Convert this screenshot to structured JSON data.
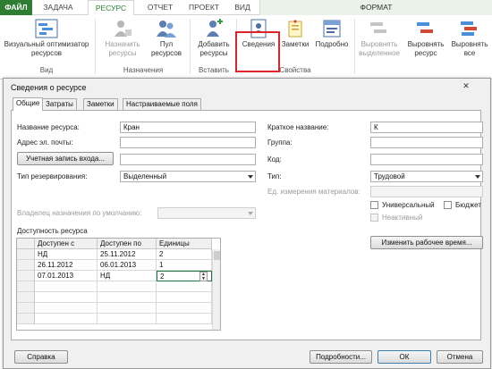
{
  "ribbon": {
    "tabs": [
      "ФАЙЛ",
      "ЗАДАЧА",
      "РЕСУРС",
      "ОТЧЕТ",
      "ПРОЕКТ",
      "ВИД"
    ],
    "format_tab": "ФОРМАТ",
    "buttons": {
      "optimizer": "Визуальный оптимизатор ресурсов",
      "assign": "Назначить ресурсы",
      "pool": "Пул ресурсов",
      "add": "Добавить ресурсы",
      "info": "Сведения",
      "notes": "Заметки",
      "details": "Подробно",
      "level_selection": "Выровнять выделенное",
      "level_resource": "Выровнять ресурс",
      "level_all": "Выровнять все"
    },
    "groups": {
      "view": "Вид",
      "assignments": "Назначения",
      "insert": "Вставить",
      "properties": "Свойства"
    },
    "colors": {
      "file_tab": "#2f7d32",
      "active_tab_text": "#2f7d32",
      "highlight": "#e0232a"
    }
  },
  "dialog": {
    "title": "Сведения о ресурсе",
    "close": "✕",
    "tabs": [
      "Общие",
      "Затраты",
      "Заметки",
      "Настраиваемые поля"
    ],
    "fields": {
      "name_label": "Название ресурса:",
      "name_value": "Кран",
      "email_label": "Адрес эл. почты:",
      "email_value": "",
      "account_button": "Учетная запись входа...",
      "booking_label": "Тип резервирования:",
      "booking_value": "Выделенный",
      "owner_label": "Владелец назначения по умолчанию:",
      "owner_value": "",
      "short_label": "Краткое название:",
      "short_value": "К",
      "group_label": "Группа:",
      "group_value": "",
      "code_label": "Код:",
      "code_value": "",
      "type_label": "Тип:",
      "type_value": "Трудовой",
      "material_label": "Ед. измерения материалов:",
      "material_value": "",
      "generic_label": "Универсальный",
      "budget_label": "Бюджет",
      "inactive_label": "Неактивный"
    },
    "availability": {
      "title": "Доступность ресурса",
      "columns": [
        "Доступен с",
        "Доступен по",
        "Единицы"
      ],
      "rows": [
        [
          "НД",
          "25.11.2012",
          "2"
        ],
        [
          "26.11.2012",
          "06.01.2013",
          "1"
        ],
        [
          "07.01.2013",
          "НД",
          "2"
        ]
      ],
      "change_button": "Изменить рабочее время..."
    },
    "footer": {
      "help": "Справка",
      "details": "Подробности...",
      "ok": "ОК",
      "cancel": "Отмена"
    }
  }
}
